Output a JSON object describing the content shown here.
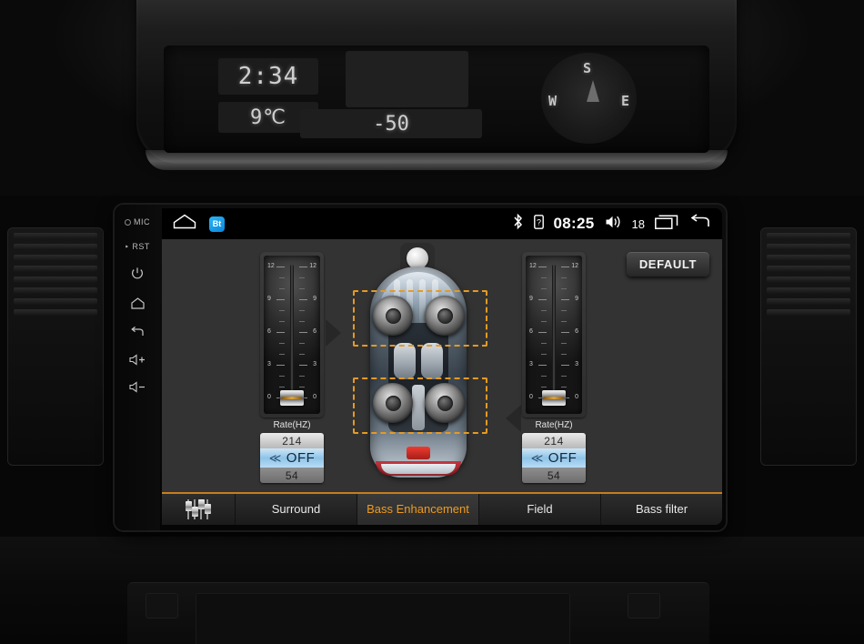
{
  "dashboard": {
    "clock": "2:34",
    "temperature": "9℃",
    "value_display": "-50",
    "compass": {
      "north": "S",
      "east": "E",
      "west": "W"
    }
  },
  "bezel": {
    "items": [
      {
        "name": "mic",
        "label": "MIC",
        "icon": "mic-icon"
      },
      {
        "name": "reset",
        "label": "RST",
        "icon": "reset-icon"
      },
      {
        "name": "power",
        "label": "",
        "icon": "power-icon"
      },
      {
        "name": "home",
        "label": "",
        "icon": "home-icon"
      },
      {
        "name": "back",
        "label": "",
        "icon": "back-icon"
      },
      {
        "name": "volume-up",
        "label": "",
        "icon": "volume-up-icon"
      },
      {
        "name": "volume-down",
        "label": "",
        "icon": "volume-down-icon"
      }
    ]
  },
  "statusbar": {
    "home_icon": "home-icon",
    "app_icon_label": "Bt",
    "bluetooth_icon": "bluetooth-icon",
    "sd_icon": "sd-card-icon",
    "time": "08:25",
    "volume_icon": "volume-icon",
    "volume_level": "18",
    "recents_icon": "recents-icon",
    "back_icon": "back-arrow-icon"
  },
  "main": {
    "default_button": "DEFAULT",
    "sliders": [
      {
        "side": "left",
        "label": "Rate(HZ)",
        "scale": [
          "12",
          "9",
          "6",
          "3",
          "0"
        ],
        "position": "0",
        "value_top": "214",
        "value_selected": "OFF",
        "value_bottom": "54",
        "chevron": "≪"
      },
      {
        "side": "right",
        "label": "Rate(HZ)",
        "scale": [
          "12",
          "9",
          "6",
          "3",
          "0"
        ],
        "position": "0",
        "value_top": "214",
        "value_selected": "OFF",
        "value_bottom": "54",
        "chevron": "≪"
      }
    ],
    "car_diagram": {
      "speakers": [
        "front-left",
        "front-right",
        "rear-left",
        "rear-right"
      ],
      "zones": [
        "front-zone",
        "rear-zone"
      ],
      "zone_color": "#e59a22"
    }
  },
  "tabs": [
    {
      "label": "",
      "name": "tab-equalizer",
      "icon": "equalizer-icon",
      "active": false
    },
    {
      "label": "Surround",
      "name": "tab-surround",
      "active": false
    },
    {
      "label": "Bass Enhancement",
      "name": "tab-bass-enhancement",
      "active": true
    },
    {
      "label": "Field",
      "name": "tab-field",
      "active": false
    },
    {
      "label": "Bass filter",
      "name": "tab-bass-filter",
      "active": false
    }
  ],
  "colors": {
    "accent": "#ef9a1e",
    "zone_border": "#e59a22",
    "screen_bg": "#333333",
    "selected_value_bg": "#8fc4e8"
  }
}
